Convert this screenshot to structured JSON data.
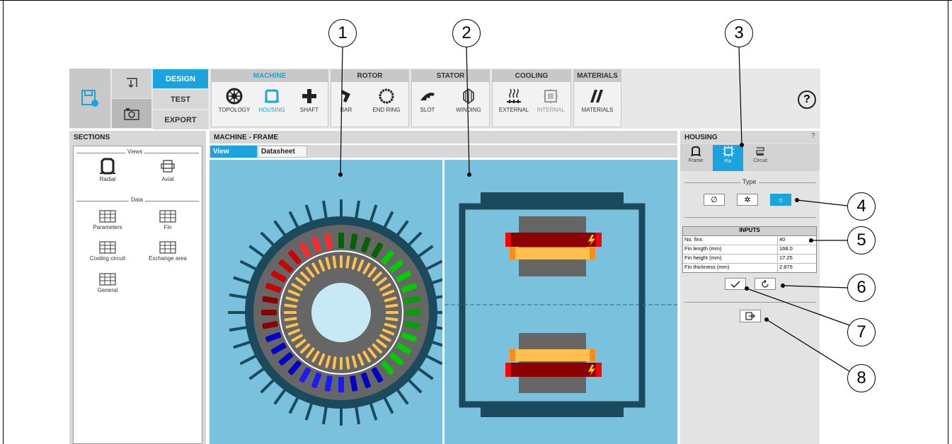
{
  "modes": {
    "design": "DESIGN",
    "test": "TEST",
    "export": "EXPORT"
  },
  "groups": {
    "machine": {
      "title": "MACHINE",
      "tools": [
        "TOPOLOGY",
        "HOUSING",
        "SHAFT"
      ]
    },
    "rotor": {
      "title": "ROTOR",
      "tools": [
        "BAR",
        "END RING"
      ]
    },
    "stator": {
      "title": "STATOR",
      "tools": [
        "SLOT",
        "WINDING"
      ]
    },
    "cooling": {
      "title": "COOLING",
      "tools": [
        "EXTERNAL",
        "INTERNAL"
      ]
    },
    "materials": {
      "title": "MATERIALS",
      "tools": [
        "MATERIALS"
      ]
    }
  },
  "help_symbol": "?",
  "sections": {
    "title": "SECTIONS",
    "views_label": "Views",
    "data_label": "Data",
    "views": [
      "Radial",
      "Axial"
    ],
    "data_items": [
      "Parameters",
      "Fin",
      "Cooling circuit",
      "Exchange area",
      "General"
    ]
  },
  "center": {
    "title": "MACHINE - FRAME",
    "tabs": [
      "View",
      "Datasheet"
    ]
  },
  "housing": {
    "title": "HOUSING",
    "help": "?",
    "tabs": [
      "Frame",
      "Fin",
      "Circuit"
    ],
    "type_label": "Type",
    "inputs": {
      "title": "INPUTS",
      "rows": [
        {
          "label": "No. fins",
          "value": "40"
        },
        {
          "label": "Fin length (mm)",
          "value": "168.0"
        },
        {
          "label": "Fin height (mm)",
          "value": "17.25"
        },
        {
          "label": "Fin thickness (mm)",
          "value": "2.875"
        }
      ]
    }
  },
  "callouts": [
    "1",
    "2",
    "3",
    "4",
    "5",
    "6",
    "7",
    "8"
  ],
  "colors": {
    "accent": "#1aa3df",
    "view_bg": "#79c1dc",
    "housing": "#1a4a5c",
    "rotor_core": "#c7e8f5",
    "stator_gray": "#666666",
    "winding_red": "#8b0000",
    "winding_orange": "#ffc04d"
  }
}
